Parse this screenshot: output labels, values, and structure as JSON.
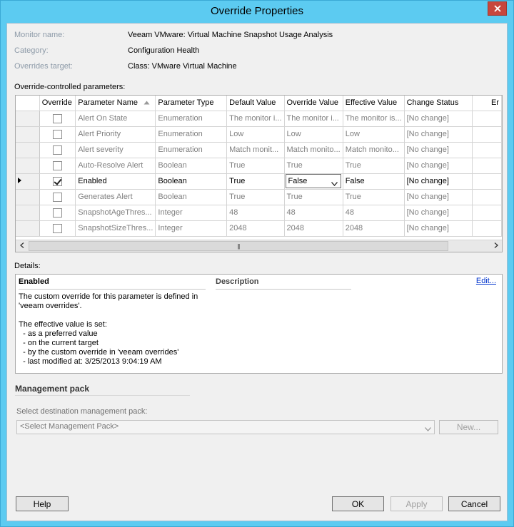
{
  "window": {
    "title": "Override Properties"
  },
  "info": [
    {
      "label": "Monitor name:",
      "value": "Veeam VMware: Virtual Machine Snapshot Usage Analysis"
    },
    {
      "label": "Category:",
      "value": "Configuration Health"
    },
    {
      "label": "Overrides target:",
      "value": "Class: VMware Virtual Machine"
    }
  ],
  "grid": {
    "section_label": "Override-controlled parameters:",
    "columns": [
      "Override",
      "Parameter Name",
      "Parameter Type",
      "Default Value",
      "Override Value",
      "Effective Value",
      "Change Status",
      "Er"
    ],
    "rows": [
      {
        "override": false,
        "name": "Alert On State",
        "type": "Enumeration",
        "default": "The monitor i...",
        "overrideValue": "The monitor i...",
        "effective": "The monitor is...",
        "status": "[No change]",
        "selected": false
      },
      {
        "override": false,
        "name": "Alert Priority",
        "type": "Enumeration",
        "default": "Low",
        "overrideValue": "Low",
        "effective": "Low",
        "status": "[No change]",
        "selected": false
      },
      {
        "override": false,
        "name": "Alert severity",
        "type": "Enumeration",
        "default": "Match monit...",
        "overrideValue": "Match monito...",
        "effective": "Match monito...",
        "status": "[No change]",
        "selected": false
      },
      {
        "override": false,
        "name": "Auto-Resolve Alert",
        "type": "Boolean",
        "default": "True",
        "overrideValue": "True",
        "effective": "True",
        "status": "[No change]",
        "selected": false
      },
      {
        "override": true,
        "name": "Enabled",
        "type": "Boolean",
        "default": "True",
        "overrideValue": "False",
        "effective": "False",
        "status": "[No change]",
        "selected": true
      },
      {
        "override": false,
        "name": "Generates Alert",
        "type": "Boolean",
        "default": "True",
        "overrideValue": "True",
        "effective": "True",
        "status": "[No change]",
        "selected": false
      },
      {
        "override": false,
        "name": "SnapshotAgeThres...",
        "type": "Integer",
        "default": "48",
        "overrideValue": "48",
        "effective": "48",
        "status": "[No change]",
        "selected": false
      },
      {
        "override": false,
        "name": "SnapshotSizeThres...",
        "type": "Integer",
        "default": "2048",
        "overrideValue": "2048",
        "effective": "2048",
        "status": "[No change]",
        "selected": false
      }
    ]
  },
  "details": {
    "section_label": "Details:",
    "title": "Enabled",
    "description_header": "Description",
    "edit_link": "Edit...",
    "body": "The custom override for this parameter is defined in\n'veeam overrides'.\n\nThe effective value is set:\n  - as a preferred value\n  - on the current target\n  - by the custom override in 'veeam overrides'\n  - last modified at: 3/25/2013 9:04:19 AM"
  },
  "management_pack": {
    "title": "Management pack",
    "select_label": "Select destination management pack:",
    "select_value": "<Select Management Pack>",
    "new_button": "New..."
  },
  "buttons": {
    "help": "Help",
    "ok": "OK",
    "apply": "Apply",
    "cancel": "Cancel"
  },
  "colors": {
    "title_bar": "#5ccbf1",
    "close_button": "#c7463c",
    "link": "#0033cc",
    "dim_text": "#808080"
  }
}
